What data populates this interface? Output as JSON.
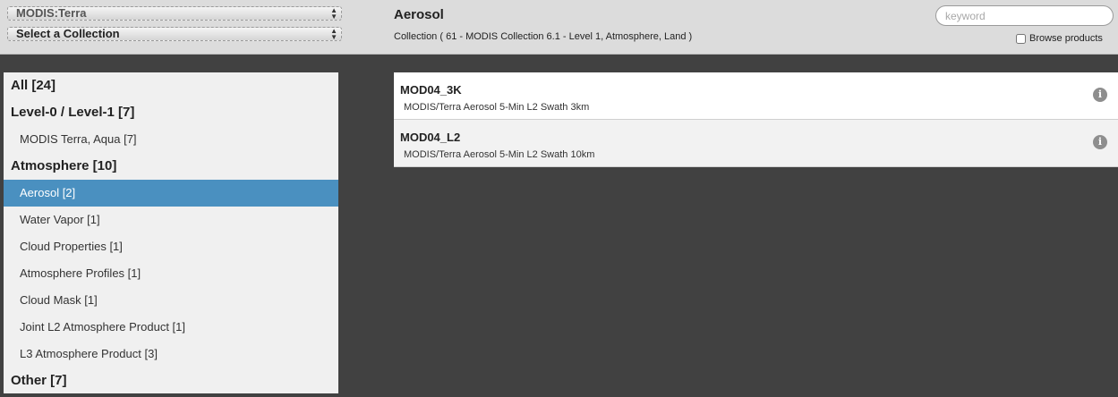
{
  "header": {
    "platform_select": "MODIS:Terra",
    "collection_select": "Select a Collection",
    "title": "Aerosol",
    "subtitle": "Collection ( 61 - MODIS Collection 6.1 - Level 1, Atmosphere, Land )",
    "search_placeholder": "keyword",
    "browse_label": "Browse products"
  },
  "sidebar": {
    "items": [
      {
        "label": "All [24]"
      },
      {
        "label": "Level-0 / Level-1 [7]"
      },
      {
        "label": "MODIS Terra, Aqua [7]"
      },
      {
        "label": "Atmosphere [10]"
      },
      {
        "label": "Aerosol [2]"
      },
      {
        "label": "Water Vapor [1]"
      },
      {
        "label": "Cloud Properties [1]"
      },
      {
        "label": "Atmosphere Profiles [1]"
      },
      {
        "label": "Cloud Mask [1]"
      },
      {
        "label": "Joint L2 Atmosphere Product [1]"
      },
      {
        "label": "L3 Atmosphere Product [3]"
      },
      {
        "label": "Other [7]"
      }
    ]
  },
  "products": [
    {
      "name": "MOD04_3K",
      "description": "MODIS/Terra Aerosol 5-Min L2 Swath 3km"
    },
    {
      "name": "MOD04_L2",
      "description": "MODIS/Terra Aerosol 5-Min L2 Swath 10km"
    }
  ],
  "icons": {
    "info": "info-icon",
    "select_arrows": "up-down-arrows-icon"
  },
  "colors": {
    "active": "#4a90c0",
    "background": "#414141",
    "header": "#dcdcdc"
  }
}
